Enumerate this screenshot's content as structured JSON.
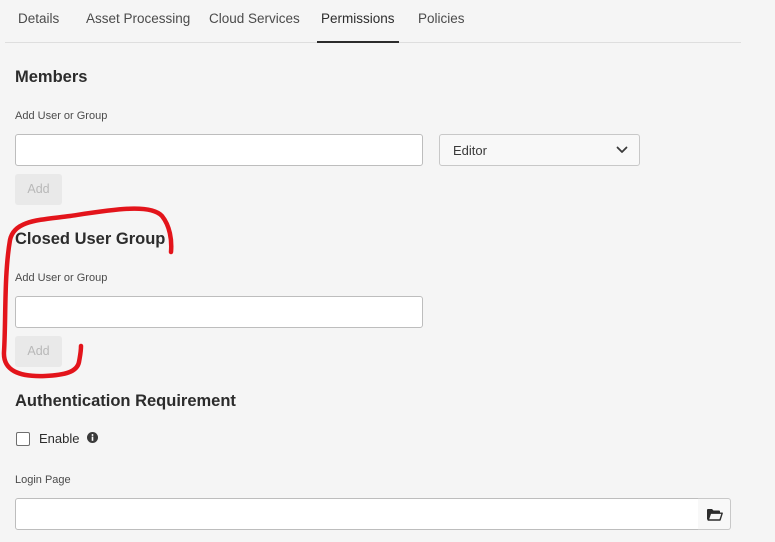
{
  "tabs": [
    {
      "label": "Details",
      "active": false
    },
    {
      "label": "Asset Processing",
      "active": false
    },
    {
      "label": "Cloud Services",
      "active": false
    },
    {
      "label": "Permissions",
      "active": true
    },
    {
      "label": "Policies",
      "active": false
    }
  ],
  "members": {
    "heading": "Members",
    "field_label": "Add User or Group",
    "input_value": "",
    "role_select": {
      "selected": "Editor"
    },
    "add_label": "Add"
  },
  "closed_user_group": {
    "heading": "Closed User Group",
    "field_label": "Add User or Group",
    "input_value": "",
    "add_label": "Add"
  },
  "authentication": {
    "heading": "Authentication Requirement",
    "enable_label": "Enable",
    "enable_checked": false,
    "login_page_label": "Login Page",
    "login_page_value": ""
  },
  "icons": {
    "select": "chevron-down-icon",
    "info": "info-icon",
    "browse": "folder-open-icon"
  },
  "colors": {
    "annotation": "#e3141b",
    "background": "#f5f5f5"
  }
}
